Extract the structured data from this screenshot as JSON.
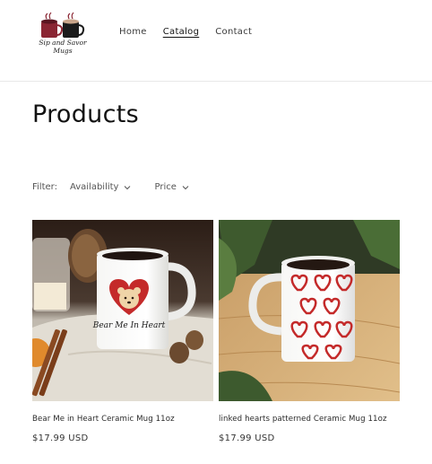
{
  "brand": {
    "logo_line1": "Sip and Savor",
    "logo_line2": "Mugs"
  },
  "nav": [
    {
      "label": "Home",
      "active": false
    },
    {
      "label": "Catalog",
      "active": true
    },
    {
      "label": "Contact",
      "active": false
    }
  ],
  "page": {
    "title": "Products"
  },
  "filters": {
    "label": "Filter:",
    "availability": "Availability",
    "price": "Price"
  },
  "products": [
    {
      "title": "Bear Me in Heart Ceramic Mug 11oz",
      "price": "$17.99 USD",
      "mug_text": "Bear Me In Heart"
    },
    {
      "title": "linked hearts patterned Ceramic Mug 11oz",
      "price": "$17.99 USD"
    }
  ],
  "colors": {
    "heart_red": "#c42a2a",
    "accent": "#121212"
  }
}
